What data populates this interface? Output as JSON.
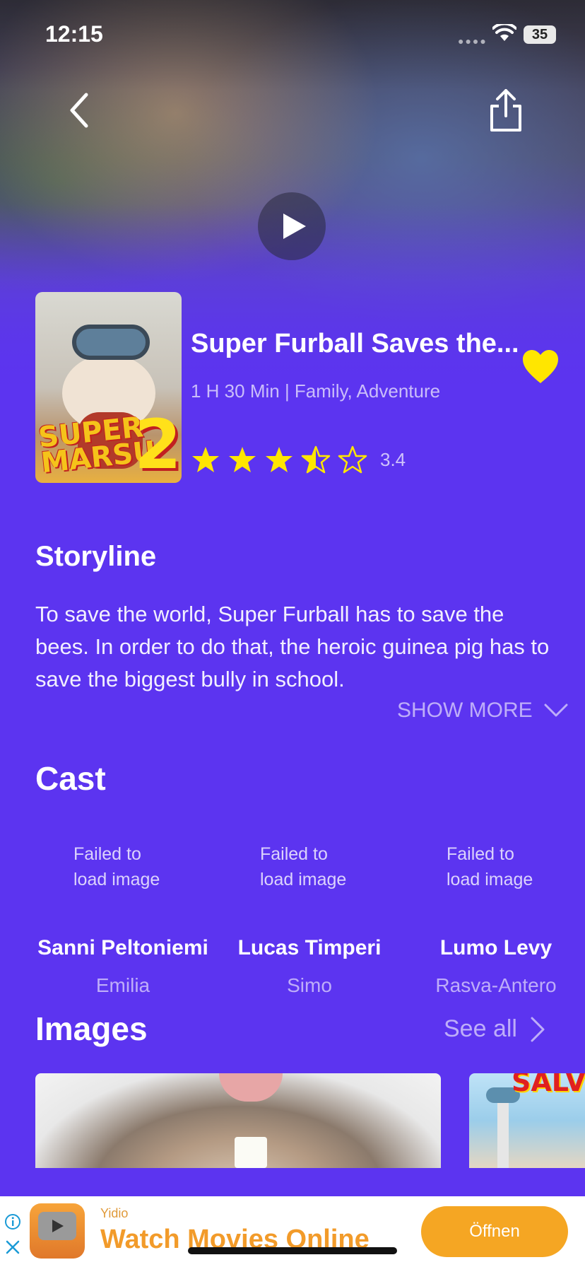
{
  "status_bar": {
    "time": "12:15",
    "battery": "35"
  },
  "movie": {
    "title": "Super Furball Saves the...",
    "meta": "1 H 30  Min | Family, Adventure",
    "rating_value": "3.4",
    "rating_stars": 3.5,
    "favorite": true,
    "poster": {
      "text_line1": "SUPER",
      "text_line2": "MARSU",
      "number": "2"
    }
  },
  "storyline": {
    "title": "Storyline",
    "text": "To save the world, Super Furball has to save the bees. In order to do that, the heroic guinea pig has to save the biggest bully in school.",
    "show_more": "SHOW MORE"
  },
  "cast": {
    "title": "Cast",
    "members": [
      {
        "image_alt": "Failed to load image",
        "name": "Sanni Peltoniemi",
        "role": "Emilia"
      },
      {
        "image_alt": "Failed to load image",
        "name": "Lucas Timperi",
        "role": "Simo"
      },
      {
        "image_alt": "Failed to load image",
        "name": "Lumo Levy",
        "role": "Rasva-Antero"
      }
    ]
  },
  "images": {
    "title": "Images",
    "see_all": "See all",
    "thumb2_text": "SALV"
  },
  "ad": {
    "sponsor": "Yidio",
    "headline": "Watch Movies Online",
    "cta": "Öffnen"
  },
  "colors": {
    "background": "#5c34f0",
    "star": "#ffe600",
    "heart": "#ffe600",
    "ad_accent": "#f5a623"
  },
  "icons": [
    "back-icon",
    "share-icon",
    "play-icon",
    "heart-icon",
    "star-icon",
    "chevron-down-icon",
    "chevron-right-icon",
    "wifi-icon",
    "info-icon",
    "close-icon"
  ]
}
